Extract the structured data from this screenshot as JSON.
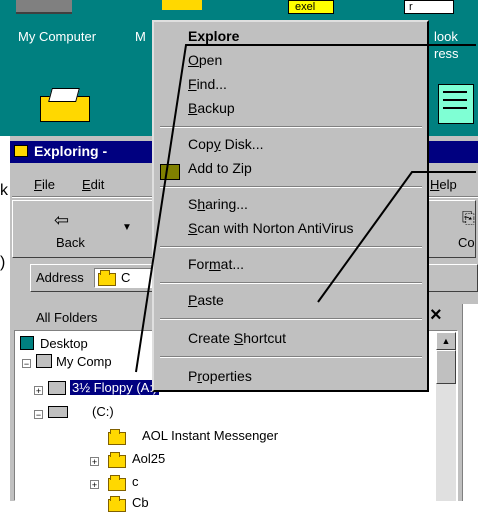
{
  "desktop": {
    "my_computer_label": "My Computer",
    "second_label_fragment": "M",
    "right_label_1": "look",
    "right_label_2": "ress",
    "top_strip_text_1": "exel",
    "top_strip_text_2": "r"
  },
  "window": {
    "title": "Exploring -",
    "menu": {
      "file": "File",
      "edit": "Edit",
      "help": "Help"
    },
    "toolbar": {
      "back": "Back",
      "copy_partial": "Co"
    },
    "address_label": "Address",
    "address_value": "C",
    "all_folders": "All Folders",
    "close_glyph": "×",
    "left_edge_chars": [
      "k",
      ")"
    ]
  },
  "tree": {
    "desktop": "Desktop",
    "my_computer": "My Comp",
    "floppy": "3½ Floppy (A:)",
    "c_drive": "(C:)",
    "items": [
      "AOL Instant Messenger",
      "Aol25",
      "c",
      "Cb"
    ]
  },
  "context_menu": {
    "items": [
      {
        "label": "Explore",
        "bold": true
      },
      {
        "label": "Open"
      },
      {
        "label": "Find..."
      },
      {
        "label": "Backup"
      },
      {
        "label": "Copy Disk..."
      },
      {
        "label": "Add to Zip"
      },
      {
        "label": "Sharing..."
      },
      {
        "label": "Scan with Norton AntiVirus"
      },
      {
        "label": "Format..."
      },
      {
        "label": "Paste"
      },
      {
        "label": "Create Shortcut"
      },
      {
        "label": "Properties"
      }
    ]
  },
  "colors": {
    "desktop_teal": "#008080",
    "title_blue": "#000080",
    "face_gray": "#c0c0c0",
    "selection_blue": "#000080"
  }
}
